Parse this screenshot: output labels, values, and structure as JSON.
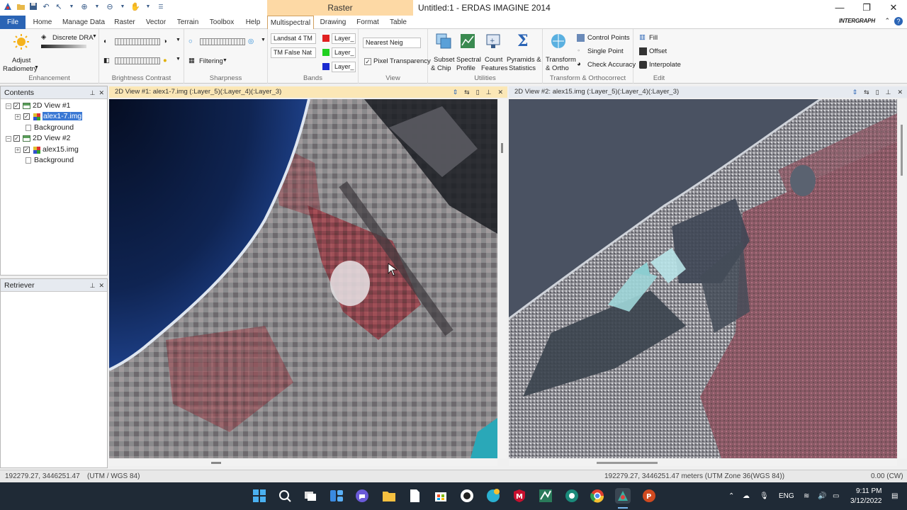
{
  "titlebar": {
    "context_tab": "Raster",
    "title": "Untitled:1 - ERDAS IMAGINE 2014",
    "minimize": "—",
    "maximize": "❐",
    "close": "✕",
    "brand": "INTERGRAPH"
  },
  "tabs": {
    "file": "File",
    "home": "Home",
    "manage_data": "Manage Data",
    "raster": "Raster",
    "vector": "Vector",
    "terrain": "Terrain",
    "toolbox": "Toolbox",
    "help": "Help",
    "multispectral": "Multispectral",
    "drawing": "Drawing",
    "format": "Format",
    "table": "Table"
  },
  "ribbon": {
    "enhancement": {
      "label": "Enhancement",
      "adjust": "Adjust",
      "radiometry": "Radiometry",
      "discrete_dra": "Discrete DRA"
    },
    "brightness": {
      "label": "Brightness Contrast"
    },
    "sharpness": {
      "label": "Sharpness",
      "filtering": "Filtering"
    },
    "bands": {
      "label": "Bands",
      "sensor": "Landsat 4 TM",
      "combo": "TM False Nat",
      "red_layer": "Layer_",
      "green_layer": "Layer_",
      "blue_layer": "Layer_"
    },
    "view": {
      "label": "View",
      "resample": "Nearest Neig",
      "pixel_transparency": "Pixel Transparency"
    },
    "utilities": {
      "label": "Utilities",
      "subset1": "Subset",
      "subset2": "& Chip",
      "spectral1": "Spectral",
      "spectral2": "Profile",
      "count1": "Count",
      "count2": "Features",
      "pyramids1": "Pyramids &",
      "pyramids2": "Statistics"
    },
    "transform": {
      "label": "Transform & Orthocorrect",
      "transform1": "Transform",
      "transform2": "& Ortho",
      "control_points": "Control Points",
      "single_point": "Single Point",
      "check_accuracy": "Check Accuracy"
    },
    "edit": {
      "label": "Edit",
      "fill": "Fill",
      "offset": "Offset",
      "interpolate": "Interpolate"
    }
  },
  "contents": {
    "title": "Contents",
    "view1": "2D View #1",
    "view1_img": "alex1-7.img",
    "view1_bg": "Background",
    "view2": "2D View #2",
    "view2_img": "alex15.img",
    "view2_bg": "Background"
  },
  "retriever": {
    "title": "Retriever"
  },
  "views": {
    "view1_title": "2D View #1: alex1-7.img (:Layer_5)(:Layer_4)(:Layer_3)",
    "view2_title": "2D View #2: alex15.img (:Layer_5)(:Layer_4)(:Layer_3)"
  },
  "status": {
    "coords_left": "192279.27, 3446251.47",
    "proj_left": "(UTM / WGS 84)",
    "coords_right": "192279.27, 3446251.47 meters (UTM Zone 36(WGS 84))",
    "rotation": "0.00 (CW)"
  },
  "taskbar": {
    "lang": "ENG",
    "time": "9:11 PM",
    "date": "3/12/2022"
  },
  "colors": {
    "file_tab": "#2a64b5",
    "context_tab": "#fdd9a5",
    "taskbar": "#1f2a36"
  }
}
